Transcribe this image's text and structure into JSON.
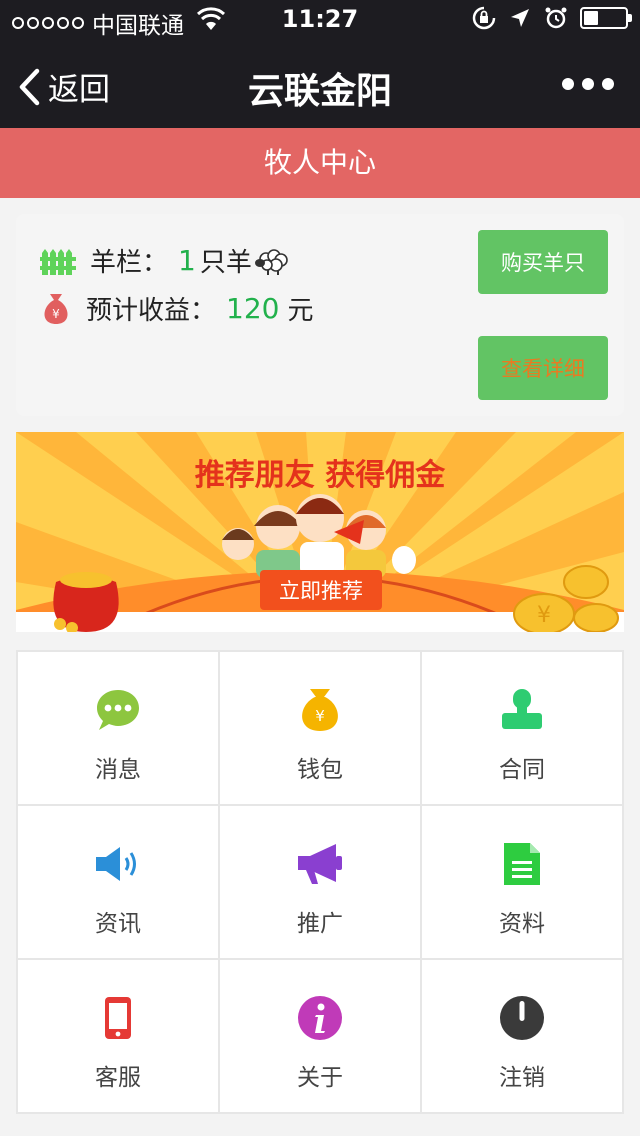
{
  "status_bar": {
    "carrier": "中国联通",
    "time": "11:27",
    "battery_level": 0.35
  },
  "nav": {
    "back_label": "返回",
    "title": "云联金阳"
  },
  "page_header": {
    "title": "牧人中心"
  },
  "card": {
    "pen_label": "羊栏：",
    "sheep_count": "1",
    "sheep_unit": "只羊",
    "income_label": "预计收益：",
    "income_value": "120",
    "income_unit": "元",
    "buy_button": "购买羊只",
    "detail_button": "查看详细"
  },
  "banner": {
    "headline": "推荐朋友 获得佣金",
    "cta": "立即推荐"
  },
  "grid": [
    {
      "label": "消息",
      "icon": "chat-icon",
      "color": "#8dc63f"
    },
    {
      "label": "钱包",
      "icon": "wallet-icon",
      "color": "#f5b400"
    },
    {
      "label": "合同",
      "icon": "contract-person-icon",
      "color": "#2ecc71"
    },
    {
      "label": "资讯",
      "icon": "speaker-icon",
      "color": "#2b8fd8"
    },
    {
      "label": "推广",
      "icon": "megaphone-icon",
      "color": "#8a3fd0"
    },
    {
      "label": "资料",
      "icon": "document-icon",
      "color": "#2ecc40"
    },
    {
      "label": "客服",
      "icon": "phone-icon",
      "color": "#e53935"
    },
    {
      "label": "关于",
      "icon": "info-icon",
      "color": "#c03ab8"
    },
    {
      "label": "注销",
      "icon": "power-icon",
      "color": "#3a3a3a"
    }
  ],
  "colors": {
    "nav_bg": "#1d1c21",
    "header_bg": "#e36664",
    "button_green": "#62c464",
    "accent_green": "#22b14c"
  }
}
